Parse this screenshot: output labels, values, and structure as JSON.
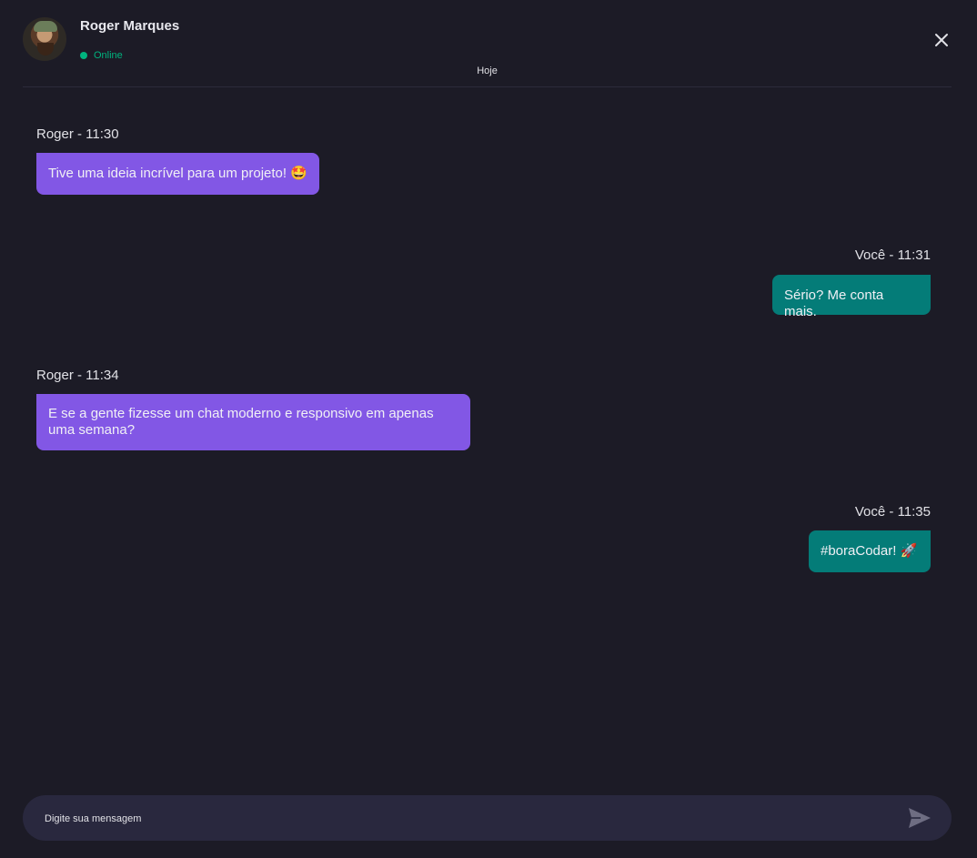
{
  "header": {
    "user_name": "Roger Marques",
    "status": "Online",
    "date_label": "Hoje"
  },
  "colors": {
    "background": "#1c1b26",
    "incoming_bubble": "#8257e5",
    "outgoing_bubble": "#047c78",
    "online": "#00b37e",
    "input_background": "#29283e"
  },
  "messages": [
    {
      "author": "Roger",
      "time": "11:30",
      "meta": "Roger - 11:30",
      "text": "Tive uma ideia incrível para um projeto! 🤩",
      "direction": "incoming"
    },
    {
      "author": "Você",
      "time": "11:31",
      "meta": "Você - 11:31",
      "text": "Sério? Me conta mais.",
      "direction": "outgoing"
    },
    {
      "author": "Roger",
      "time": "11:34",
      "meta": "Roger - 11:34",
      "text": "E se a gente fizesse um chat moderno e responsivo em apenas uma semana?",
      "direction": "incoming"
    },
    {
      "author": "Você",
      "time": "11:35",
      "meta": "Você - 11:35",
      "text": "#boraCodar! 🚀",
      "direction": "outgoing"
    }
  ],
  "composer": {
    "placeholder": "Digite sua mensagem",
    "value": ""
  },
  "icons": {
    "close": "close-icon",
    "send": "send-icon",
    "status": "online-dot-icon"
  }
}
